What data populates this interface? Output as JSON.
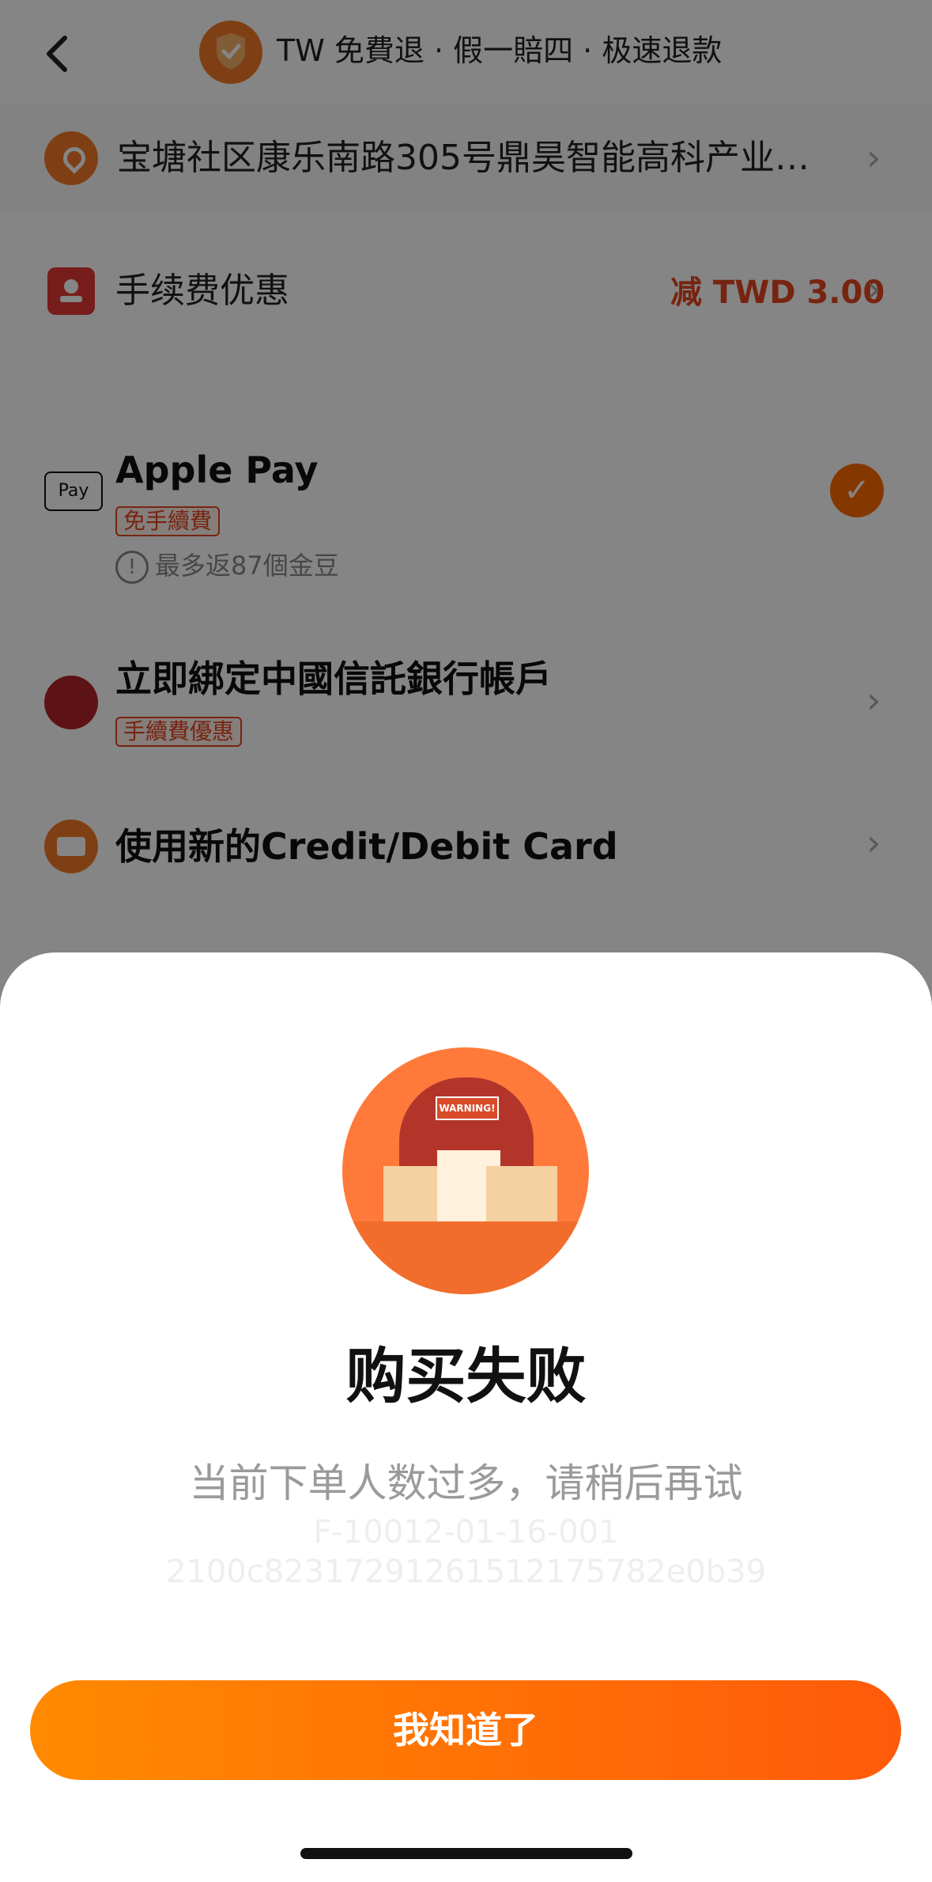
{
  "header": {
    "title": "TW 免費退 · 假一賠四 · 极速退款",
    "back_icon": "chevron-left-icon",
    "shield_icon": "shield-check-icon"
  },
  "address": {
    "text": "宝塘社区康乐南路305号鼎昊智能高科产业…",
    "icon": "location-pin-icon"
  },
  "fee_discount": {
    "label": "手续费优惠",
    "value": "减 TWD 3.00"
  },
  "payment_methods": [
    {
      "name": "Apple Pay",
      "badge": "免手續費",
      "note": "最多返87個金豆",
      "selected": true,
      "logo": "Pay"
    },
    {
      "name": "立即綁定中國信託銀行帳戶",
      "badge": "手續費優惠"
    },
    {
      "name": "使用新的Credit/Debit Card"
    }
  ],
  "modal": {
    "illustration_text": "WARNING!",
    "title": "购买失败",
    "message": "当前下单人数过多，请稍后再试",
    "code_line1": "F-10012-01-16-001",
    "code_line2": "2100c82317291261512175782e0b39",
    "button_label": "我知道了"
  },
  "colors": {
    "accent": "#ff6a00",
    "discount": "#e5461f"
  }
}
